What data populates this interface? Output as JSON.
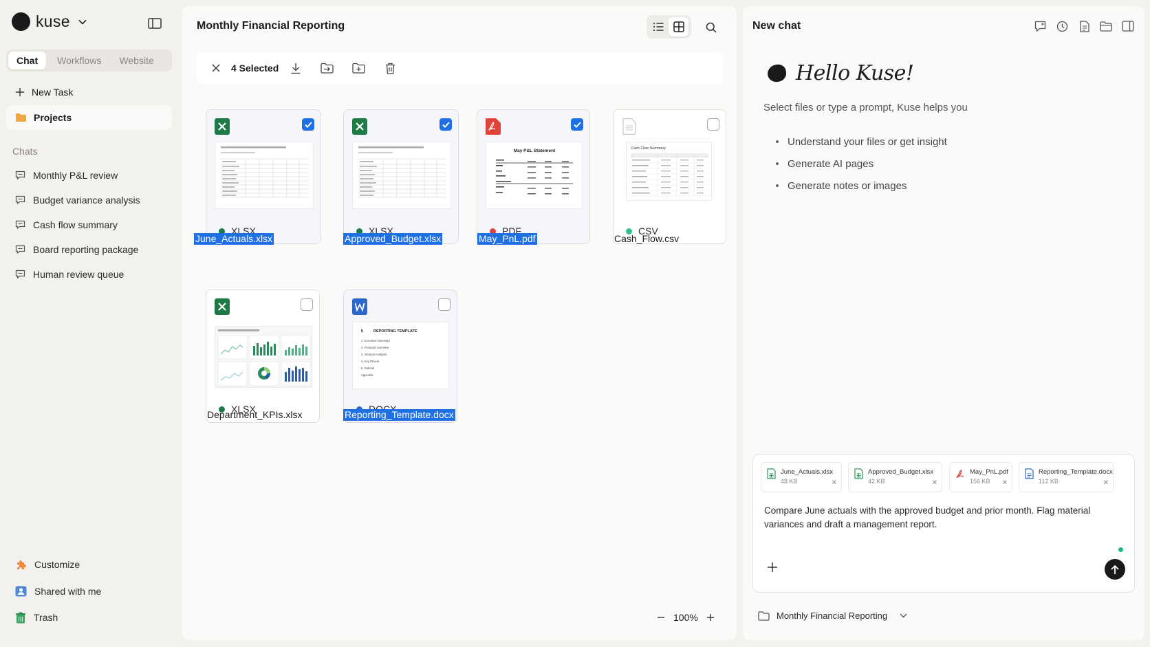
{
  "brand": {
    "name": "kuse"
  },
  "sidebar": {
    "tabs": [
      {
        "label": "Chat",
        "active": true
      },
      {
        "label": "Workflows",
        "active": false
      },
      {
        "label": "Website",
        "active": false
      }
    ],
    "new_task": "New Task",
    "projects": "Projects",
    "chats_heading": "Chats",
    "chats": [
      "Monthly P&L review",
      "Budget variance analysis",
      "Cash flow summary",
      "Board reporting package",
      "Human review queue"
    ],
    "customize": "Customize",
    "shared": "Shared with me",
    "trash": "Trash"
  },
  "main": {
    "title": "Monthly Financial Reporting",
    "selection_label": "4 Selected",
    "files": [
      {
        "name": "June_Actuals.xlsx",
        "type": "XLSX",
        "selected": true
      },
      {
        "name": "Approved_Budget.xlsx",
        "type": "XLSX",
        "selected": true
      },
      {
        "name": "May_PnL.pdf",
        "type": "PDF",
        "selected": true
      },
      {
        "name": "Cash_Flow.csv",
        "type": "CSV",
        "selected": false
      },
      {
        "name": "Department_KPIs.xlsx",
        "type": "XLSX",
        "selected": false
      },
      {
        "name": "Reporting_Template.docx",
        "type": "DOCX",
        "selected": true
      }
    ],
    "thumbs": {
      "may_title": "May P&L Statement",
      "cash_title": "Cash Flow Summary",
      "template_title": "REPORTING TEMPLATE",
      "template_items": [
        "1. Executive Summary",
        "2. Financial Overview",
        "3. Variance Analysis",
        "4. Key Drivers",
        "5. Outlook",
        "Appendix"
      ]
    },
    "zoom": "100%"
  },
  "chat": {
    "title": "New chat",
    "greeting": "Hello Kuse!",
    "subtitle": "Select files or type a prompt, Kuse helps you",
    "tips": [
      "Understand your files or get insight",
      "Generate AI pages",
      "Generate notes or images"
    ],
    "attachments": [
      {
        "name": "June_Actuals.xlsx",
        "size": "48 KB",
        "kind": "sheet"
      },
      {
        "name": "Approved_Budget.xlsx",
        "size": "42 KB",
        "kind": "sheet"
      },
      {
        "name": "May_PnL.pdf",
        "size": "156 KB",
        "kind": "pdf"
      },
      {
        "name": "Reporting_Template.docx",
        "size": "112 KB",
        "kind": "doc"
      }
    ],
    "prompt": "Compare June actuals with the approved budget and prior month. Flag material variances and draft a management report.",
    "project": "Monthly Financial Reporting"
  },
  "colors": {
    "accent": "#1f6fe5",
    "xlsx": "#1e7a45",
    "pdf": "#e0433a",
    "csv": "#36c08b",
    "docx": "#2b68c9"
  }
}
